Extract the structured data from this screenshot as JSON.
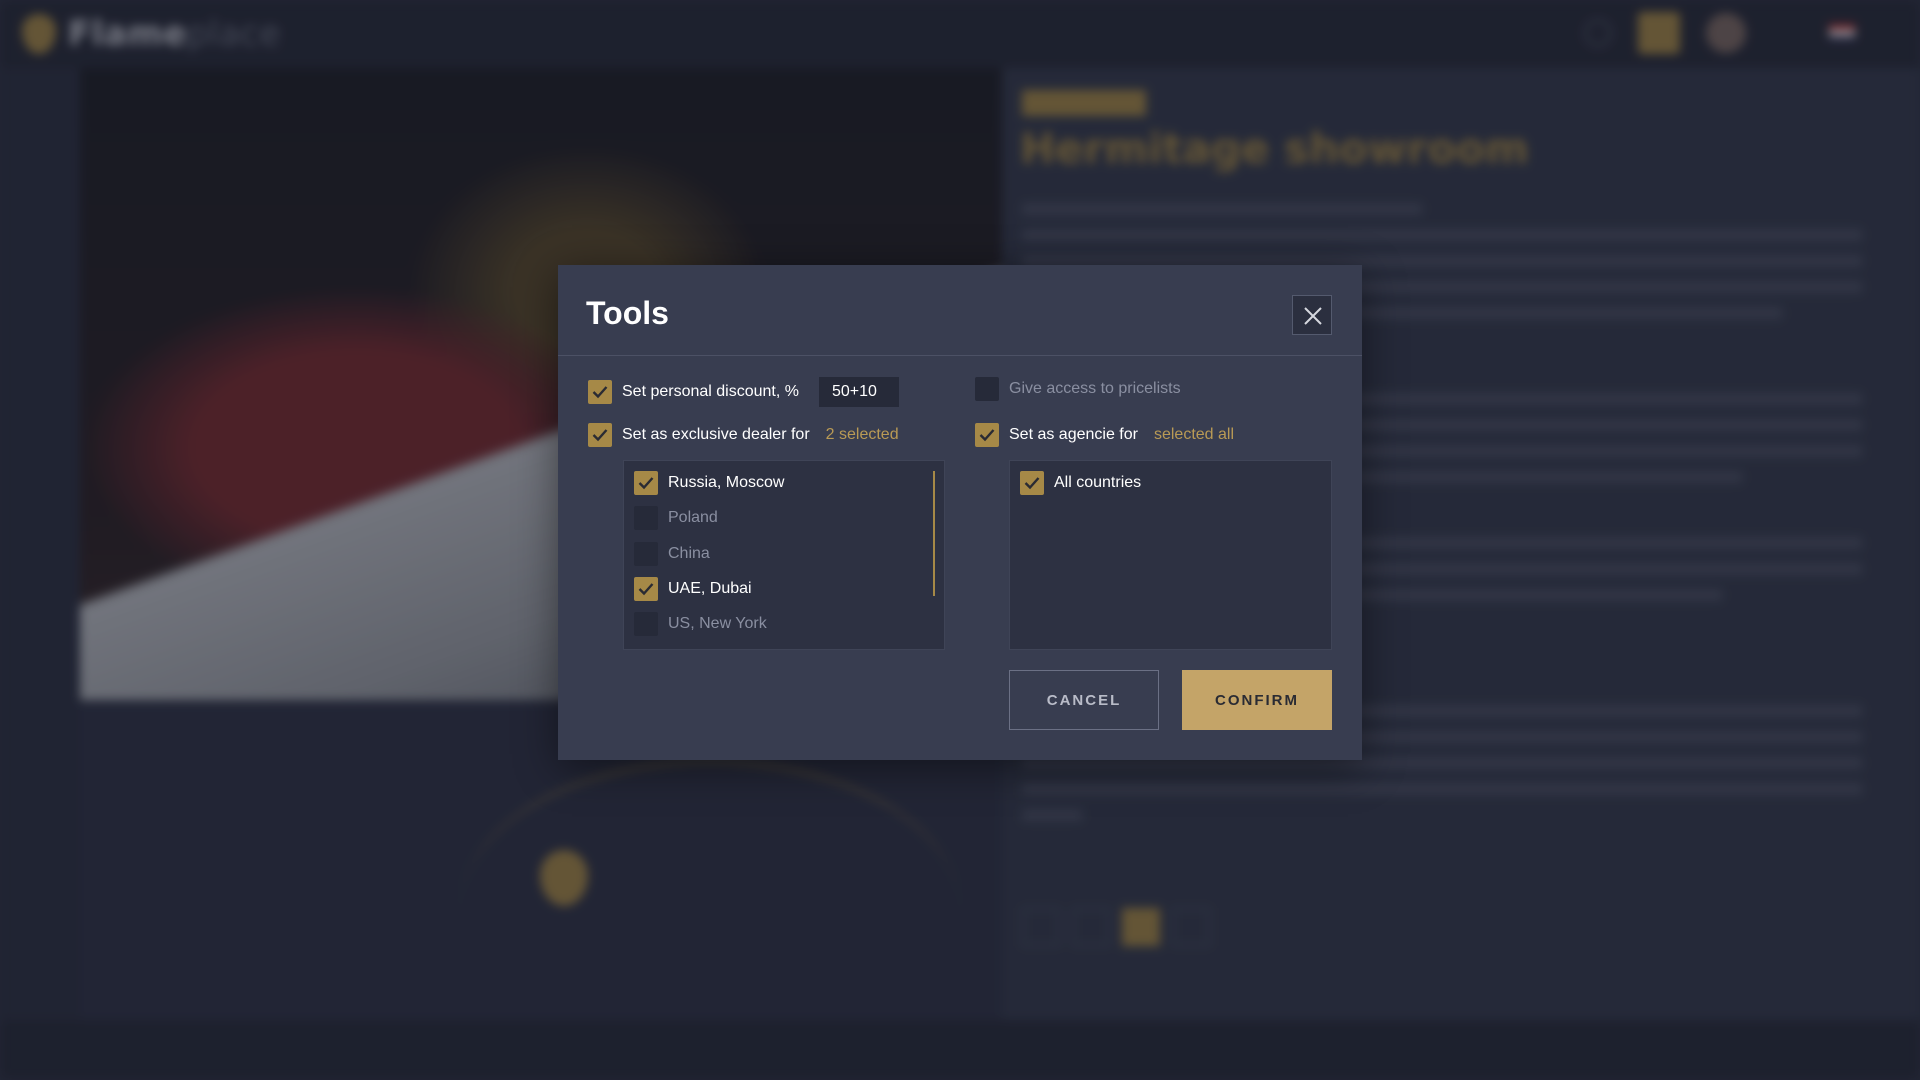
{
  "background": {
    "brand": "Flameplace",
    "brand_bold": "Flame",
    "brand_thin": "place",
    "title": "Hermitage showroom"
  },
  "modal": {
    "title": "Tools",
    "personal_discount": {
      "label": "Set personal discount, %",
      "checked": true,
      "value": "50+10"
    },
    "pricelists": {
      "label": "Give access to pricelists",
      "checked": false
    },
    "exclusive_dealer": {
      "label": "Set as exclusive dealer for",
      "checked": true,
      "summary": "2 selected",
      "items": [
        {
          "label": "Russia, Moscow",
          "checked": true
        },
        {
          "label": "Poland",
          "checked": false
        },
        {
          "label": "China",
          "checked": false
        },
        {
          "label": "UAE, Dubai",
          "checked": true
        },
        {
          "label": "US, New York",
          "checked": false
        }
      ]
    },
    "agencie": {
      "label": "Set as agencie for",
      "checked": true,
      "summary": "selected all",
      "items": [
        {
          "label": "All countries",
          "checked": true
        }
      ]
    },
    "cancel_label": "CANCEL",
    "confirm_label": "CONFIRM"
  },
  "colors": {
    "accent": "#a68947",
    "confirm_bg": "#c4a468",
    "modal_bg": "#383d50"
  }
}
